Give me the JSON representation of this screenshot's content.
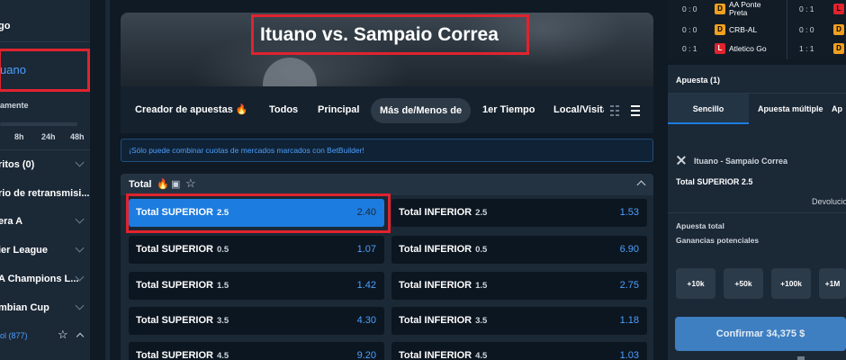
{
  "sidebar": {
    "top_item": "go",
    "selected_team": "uano",
    "period_label": "amente",
    "hours": [
      "8h",
      "24h",
      "48h"
    ],
    "items": [
      {
        "label": "ritos (0)"
      },
      {
        "label": "rio de retransmisi..."
      },
      {
        "label": "era A"
      },
      {
        "label": "ier League"
      },
      {
        "label": "A Champions L..."
      },
      {
        "label": "mbian Cup"
      }
    ],
    "fav_label": "ol (877)"
  },
  "event": {
    "title": "Ituano vs. Sampaio Correa"
  },
  "tabs": [
    {
      "label": "Creador de apuestas 🔥"
    },
    {
      "label": "Todos"
    },
    {
      "label": "Principal"
    },
    {
      "label": "Más de/Menos de"
    },
    {
      "label": "1er Tiempo"
    },
    {
      "label": "Local/Visita"
    }
  ],
  "info_banner": "¡Sólo puede combinar cuotas de mercados marcados con BetBuilder!",
  "market": {
    "title": "Total",
    "rows": [
      {
        "left": {
          "name": "Total SUPERIOR",
          "line": "2.5",
          "price": "2.40",
          "selected": true
        },
        "right": {
          "name": "Total INFERIOR",
          "line": "2.5",
          "price": "1.53"
        }
      },
      {
        "left": {
          "name": "Total SUPERIOR",
          "line": "0.5",
          "price": "1.07"
        },
        "right": {
          "name": "Total INFERIOR",
          "line": "0.5",
          "price": "6.90"
        }
      },
      {
        "left": {
          "name": "Total SUPERIOR",
          "line": "1.5",
          "price": "1.42"
        },
        "right": {
          "name": "Total INFERIOR",
          "line": "1.5",
          "price": "2.75"
        }
      },
      {
        "left": {
          "name": "Total SUPERIOR",
          "line": "3.5",
          "price": "4.30"
        },
        "right": {
          "name": "Total INFERIOR",
          "line": "3.5",
          "price": "1.18"
        }
      },
      {
        "left": {
          "name": "Total SUPERIOR",
          "line": "4.5",
          "price": "9.20"
        },
        "right": {
          "name": "Total INFERIOR",
          "line": "4.5",
          "price": "1.03"
        }
      }
    ]
  },
  "live_scores": [
    {
      "score": "0 : 0",
      "badge": "D",
      "team": "AA Ponte\nPreta",
      "score2": "0 : 1",
      "badge2": "L"
    },
    {
      "score": "0 : 0",
      "badge": "D",
      "team": "CRB-AL",
      "score2": "0 : 0",
      "badge2": "D"
    },
    {
      "score": "0 : 1",
      "badge": "L",
      "team": "Atletico Go",
      "score2": "1 : 1",
      "badge2": "D"
    }
  ],
  "betslip": {
    "title": "Apuesta (1)",
    "tab_single": "Sencillo",
    "tab_multi": "Apuesta múltiple",
    "tab_system": "Ap",
    "match": "Ituano - Sampaio Correa",
    "selection": "Total SUPERIOR 2.5",
    "devolucion": "Devolucio",
    "total_label": "Apuesta total",
    "potential_label": "Ganancias potenciales",
    "stakes": [
      "+10k",
      "+50k",
      "+100k",
      "+1M"
    ],
    "confirm": "Confirmar 34,375 $"
  },
  "colors": {
    "accent": "#1d7ce0",
    "odds": "#4d9fff",
    "highlight": "#e0232e",
    "draw_badge": "#f0a020",
    "loss_badge": "#e0232e"
  }
}
